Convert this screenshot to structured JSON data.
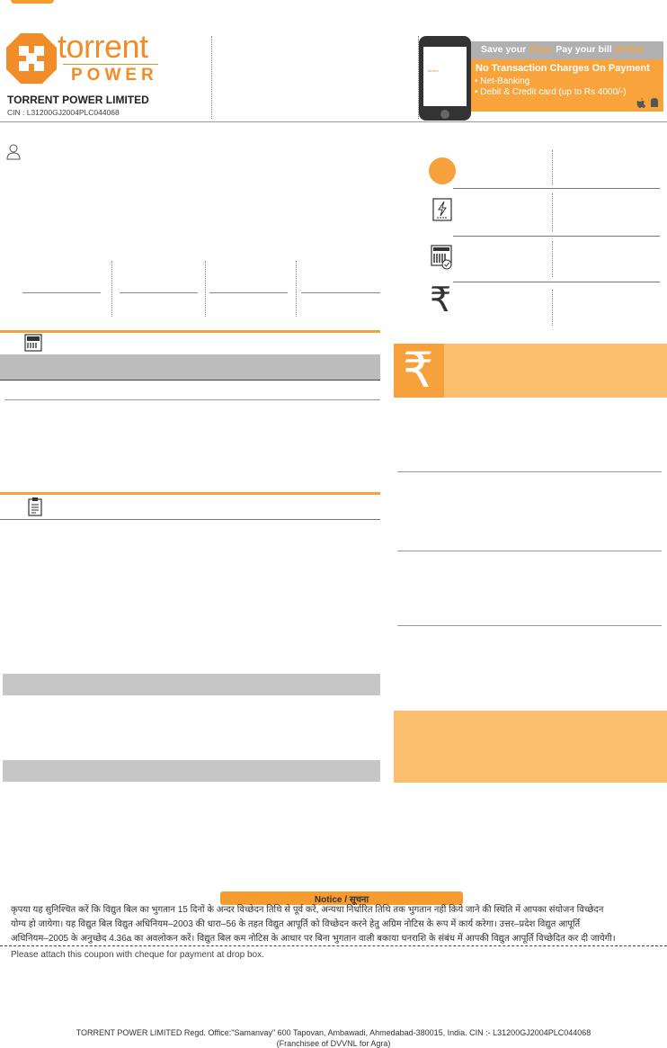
{
  "header": {
    "logo_word": "torrent",
    "logo_sub": "POWER",
    "company_name": "TORRENT POWER LIMITED",
    "cin": "CIN : L31200GJ2004PLC044068"
  },
  "promo": {
    "bar_text_a": "Save your ",
    "bar_text_b": "Time, ",
    "bar_text_c": "Pay your bill ",
    "bar_text_d": "Online",
    "heading": "No Transaction Charges On Payment",
    "items": [
      "Net-Banking",
      "Debit & Credit card (up to Rs 4000/-)"
    ],
    "mini_logo": "torrent"
  },
  "icons": {
    "rupee": "₹",
    "os": ""
  },
  "notice": {
    "title": "Notice / सूचना",
    "lines": [
      "कृपया यह सुनिश्चित करें कि विद्युत बिल का भुगतान 15 दिनों के अन्दर विच्छेदन तिथि से पूर्व करें, अन्यथा निर्धारित तिथि तक भुगतान नहीं किये जाने की स्थिति में आपका संयोजन विच्छेदन",
      "योग्य हो जायेगा। यह विद्युत बिल विद्युत अधिनियम–2003 की धारा–56 के तहत विद्युत आपूर्ति को विच्छेदन करने हेतु अग्रिम नोटिस के रूप में कार्य करेगा। उत्तर–प्रदेश विद्युत आपूर्ति",
      "अधिनियम–2005 के अनुच्छेद 4.36a का अवलोकन करें। विद्युत बिल कम नोटिस के आधार पर बिना भुगतान वाली बकाया धनराशि के संबंध में आपकी विद्युत आपूर्ति विच्छेदित कर दी जायेगी।"
    ]
  },
  "coupon_text": "Please attach this coupon with cheque for payment at drop box.",
  "footer": {
    "line1": "TORRENT POWER LIMITED Regd. Office:\"Samanvay\" 600 Tapovan, Ambawadi, Ahmedabad-380015, India. CIN :- L31200GJ2004PLC044068",
    "line2": "(Franchisee of DVVNL for Agra)"
  }
}
